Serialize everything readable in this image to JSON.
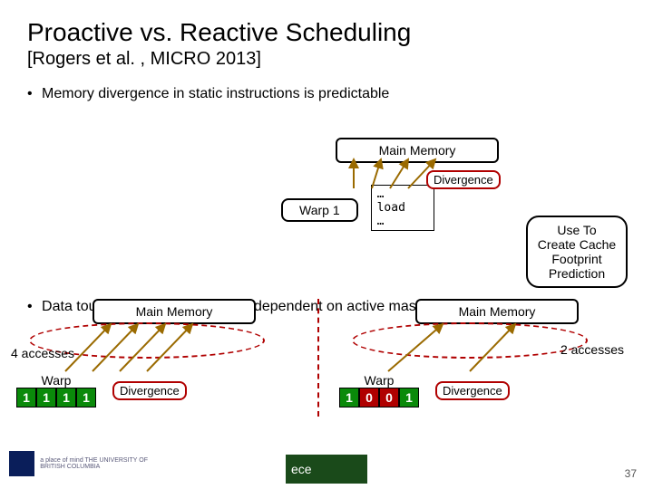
{
  "title": "Proactive vs. Reactive Scheduling",
  "citation": "[Rogers et al. , MICRO 2013]",
  "bullet1": "Memory divergence in static instructions is predictable",
  "bullet2": "Data touched by divergent loads dependent on active mask",
  "main_memory": "Main Memory",
  "warp1": "Warp 1",
  "divergence": "Divergence",
  "code": {
    "l1": "…",
    "l2": "load",
    "l3": "…"
  },
  "callout": {
    "l1": "Use To",
    "l2": "Create Cache",
    "l3": "Footprint",
    "l4": "Prediction"
  },
  "left": {
    "accesses": "4 accesses",
    "warp": "Warp",
    "mask": [
      "1",
      "1",
      "1",
      "1"
    ],
    "mask_colors": [
      "g",
      "g",
      "g",
      "g"
    ]
  },
  "right": {
    "accesses": "2 accesses",
    "warp": "Warp",
    "mask": [
      "1",
      "0",
      "0",
      "1"
    ],
    "mask_colors": [
      "g",
      "r",
      "r",
      "g"
    ]
  },
  "page": "37",
  "ubc_text": "a place of mind  THE UNIVERSITY OF BRITISH COLUMBIA",
  "ece": "ece"
}
